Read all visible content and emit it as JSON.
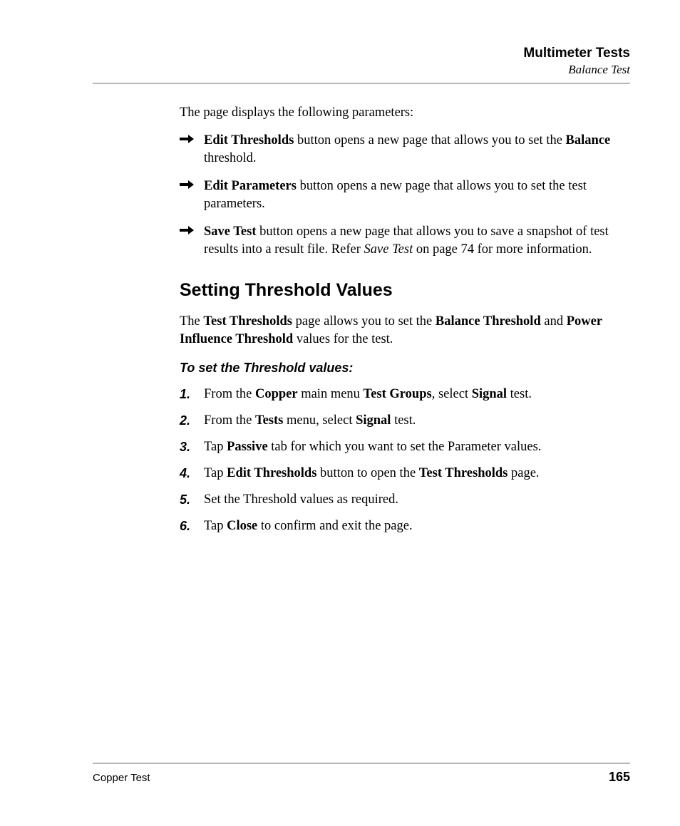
{
  "header": {
    "title": "Multimeter Tests",
    "subtitle": "Balance Test"
  },
  "intro": "The page displays the following parameters:",
  "bullets": [
    {
      "lead": "Edit Thresholds",
      "mid1": " button opens a new page that allows you to set the ",
      "bold2": "Balance",
      "tail": " threshold."
    },
    {
      "lead": "Edit Parameters",
      "mid1": " button opens a new page that allows you to set the test parameters.",
      "bold2": "",
      "tail": ""
    },
    {
      "lead": "Save Test",
      "mid1": " button opens a new page that allows you to save a snapshot of test results into a result file. Refer ",
      "ital": "Save Test",
      "tail": " on page 74 for more information."
    }
  ],
  "section_heading": "Setting Threshold Values",
  "section_intro_parts": {
    "p1": "The ",
    "b1": "Test Thresholds",
    "p2": " page allows you to set the ",
    "b2": "Balance Threshold",
    "p3": " and ",
    "b3": "Power Influence Threshold",
    "p4": " values for the test."
  },
  "subhead": "To set the Threshold values:",
  "steps": [
    {
      "pre": "From the ",
      "b1": "Copper",
      "mid": " main menu ",
      "b2": "Test Groups",
      "mid2": ", select ",
      "b3": "Signal",
      "post": " test."
    },
    {
      "pre": "From the ",
      "b1": "Tests",
      "mid": " menu, select ",
      "b2": "Signal",
      "mid2": "",
      "b3": "",
      "post": " test."
    },
    {
      "pre": "Tap ",
      "b1": "Passive",
      "mid": " tab for which you want to set the Parameter values.",
      "b2": "",
      "mid2": "",
      "b3": "",
      "post": ""
    },
    {
      "pre": "Tap ",
      "b1": "Edit Thresholds",
      "mid": " button to open the ",
      "b2": "Test Thresholds",
      "mid2": "",
      "b3": "",
      "post": " page."
    },
    {
      "pre": "Set the Threshold values as required.",
      "b1": "",
      "mid": "",
      "b2": "",
      "mid2": "",
      "b3": "",
      "post": ""
    },
    {
      "pre": "Tap ",
      "b1": "Close",
      "mid": " to confirm and exit the page.",
      "b2": "",
      "mid2": "",
      "b3": "",
      "post": ""
    }
  ],
  "footer": {
    "left": "Copper Test",
    "right": "165"
  }
}
